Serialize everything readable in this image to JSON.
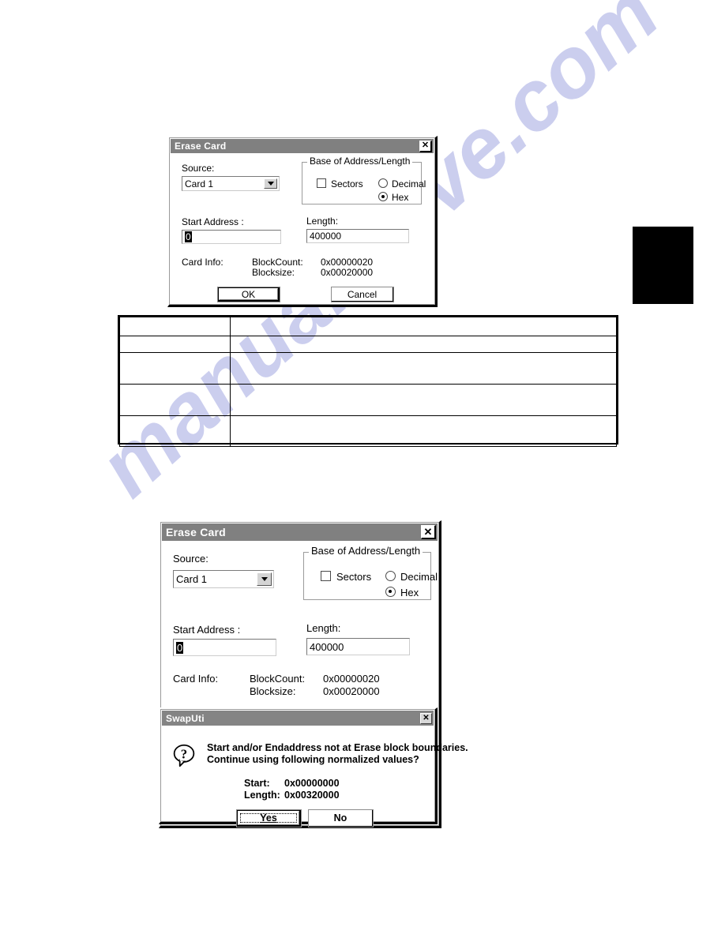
{
  "page": {
    "watermark_text": "manualshive.com",
    "background_color": "#ffffff",
    "tab_marker_color": "#000000"
  },
  "dialog_top": {
    "title": "Erase Card",
    "close_icon": "close-icon",
    "source_label": "Source:",
    "source_value": "Card 1",
    "source_options": [
      "Card 1"
    ],
    "group_title": "Base of Address/Length",
    "sectors_label": "Sectors",
    "sectors_checked": false,
    "decimal_label": "Decimal",
    "hex_label": "Hex",
    "base_selected": "Hex",
    "start_address_label": "Start Address :",
    "start_address_value": "0",
    "length_label": "Length:",
    "length_value": "400000",
    "card_info_label": "Card Info:",
    "blockcount_label": "BlockCount:",
    "blockcount_value": "0x00000020",
    "blocksize_label": "Blocksize:",
    "blocksize_value": "0x00020000",
    "ok_label": "OK",
    "cancel_label": "Cancel"
  },
  "table": {
    "columns": [
      "",
      ""
    ],
    "rows": [
      [
        "",
        ""
      ],
      [
        "",
        ""
      ],
      [
        "",
        ""
      ],
      [
        "",
        ""
      ],
      [
        "",
        ""
      ]
    ]
  },
  "dialog_bottom": {
    "title": "Erase Card",
    "close_icon": "close-icon",
    "source_label": "Source:",
    "source_value": "Card 1",
    "source_options": [
      "Card 1"
    ],
    "group_title": "Base of Address/Length",
    "sectors_label": "Sectors",
    "sectors_checked": false,
    "decimal_label": "Decimal",
    "hex_label": "Hex",
    "base_selected": "Hex",
    "start_address_label": "Start Address :",
    "start_address_value": "0",
    "length_label": "Length:",
    "length_value": "400000",
    "card_info_label": "Card Info:",
    "blockcount_label": "BlockCount:",
    "blockcount_value": "0x00000020",
    "blocksize_label": "Blocksize:",
    "blocksize_value": "0x00020000"
  },
  "msgbox": {
    "title": "SwapUti",
    "close_icon": "close-icon",
    "icon": "question-icon",
    "message_line1": "Start and/or Endaddress not at Erase block boundaries.",
    "message_line2": "Continue using following normalized values?",
    "start_label": "Start:",
    "start_value": "0x00000000",
    "length_label": "Length:",
    "length_value": "0x00320000",
    "yes_label": "Yes",
    "no_label": "No"
  }
}
